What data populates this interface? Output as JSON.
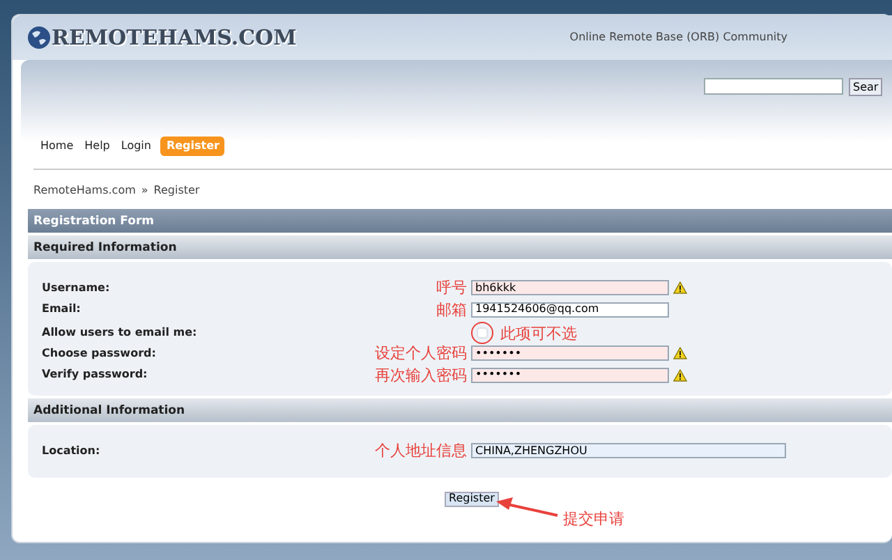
{
  "header": {
    "logo": "REMOTEHAMS.COM",
    "tagline": "Online Remote Base (ORB) Community"
  },
  "search": {
    "button": "Sear"
  },
  "nav": [
    {
      "label": "Home",
      "selected": false
    },
    {
      "label": "Help",
      "selected": false
    },
    {
      "label": "Login",
      "selected": false
    },
    {
      "label": "Register",
      "selected": true
    }
  ],
  "breadcrumb": [
    "RemoteHams.com",
    "»",
    "Register"
  ],
  "form_title": "Registration Form",
  "sections": [
    {
      "title": "Required Information",
      "fields": [
        {
          "kind": "text",
          "label": "Username:",
          "value": "bh6kkk",
          "warning": true,
          "annotation": "呼号"
        },
        {
          "kind": "text",
          "label": "Email:",
          "value": "1941524606@qq.com",
          "warning": false,
          "annotation": "邮箱"
        },
        {
          "kind": "checkbox",
          "label": "Allow users to email me:",
          "checked": false,
          "annotation": "此项可不选"
        },
        {
          "kind": "text",
          "label": "Choose password:",
          "value": "•••••••",
          "warning": true,
          "annotation": "设定个人密码"
        },
        {
          "kind": "text",
          "label": "Verify password:",
          "value": "•••••••",
          "warning": true,
          "annotation": "再次输入密码"
        }
      ]
    },
    {
      "title": "Additional Information",
      "fields": [
        {
          "kind": "wide",
          "label": "Location:",
          "value": "CHINA,ZHENGZHOU",
          "warning": false,
          "annotation": "个人地址信息"
        }
      ]
    }
  ],
  "submit": {
    "label": "Register",
    "annotation": "提交申请"
  }
}
